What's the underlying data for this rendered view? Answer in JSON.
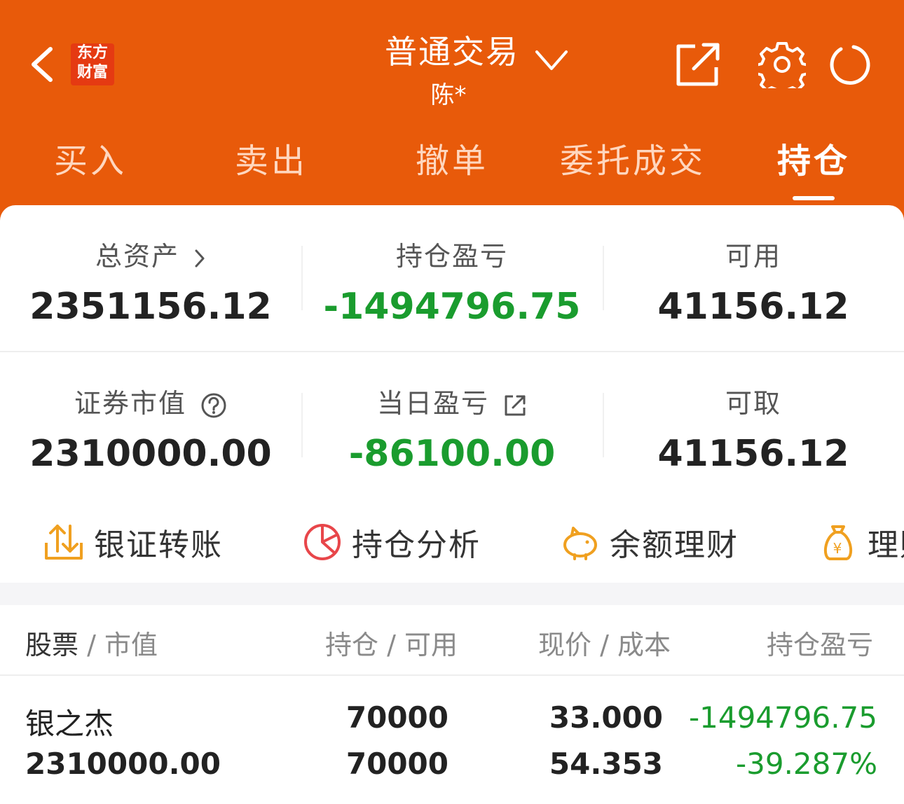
{
  "header": {
    "title": "普通交易",
    "subtitle": "陈*",
    "logo_line1": "东方",
    "logo_line2": "财富",
    "background_color": "#e85a0a"
  },
  "tabs": [
    {
      "label": "买入",
      "active": false
    },
    {
      "label": "卖出",
      "active": false
    },
    {
      "label": "撤单",
      "active": false
    },
    {
      "label": "委托成交",
      "active": false
    },
    {
      "label": "持仓",
      "active": true
    }
  ],
  "summary": {
    "total_assets_label": "总资产",
    "total_assets": "2351156.12",
    "position_pl_label": "持仓盈亏",
    "position_pl": "-1494796.75",
    "available_label": "可用",
    "available": "41156.12",
    "market_value_label": "证券市值",
    "market_value": "2310000.00",
    "daily_pl_label": "当日盈亏",
    "daily_pl": "-86100.00",
    "withdrawable_label": "可取",
    "withdrawable": "41156.12",
    "loss_color": "#1a9c2e"
  },
  "quick_actions": [
    {
      "label": "银证转账",
      "icon": "transfer-icon"
    },
    {
      "label": "持仓分析",
      "icon": "pie-chart-icon"
    },
    {
      "label": "余额理财",
      "icon": "piggy-bank-icon"
    },
    {
      "label": "理财",
      "icon": "money-bag-icon"
    }
  ],
  "table": {
    "headers": {
      "stock": "股票",
      "stock_sub": "市值",
      "position": "持仓",
      "position_sub": "可用",
      "price": "现价",
      "price_sub": "成本",
      "pl": "持仓盈亏"
    },
    "rows": [
      {
        "name": "银之杰",
        "market_value": "2310000.00",
        "position": "70000",
        "available": "70000",
        "price": "33.000",
        "cost": "54.353",
        "pl": "-1494796.75",
        "pl_pct": "-39.287%"
      }
    ]
  }
}
